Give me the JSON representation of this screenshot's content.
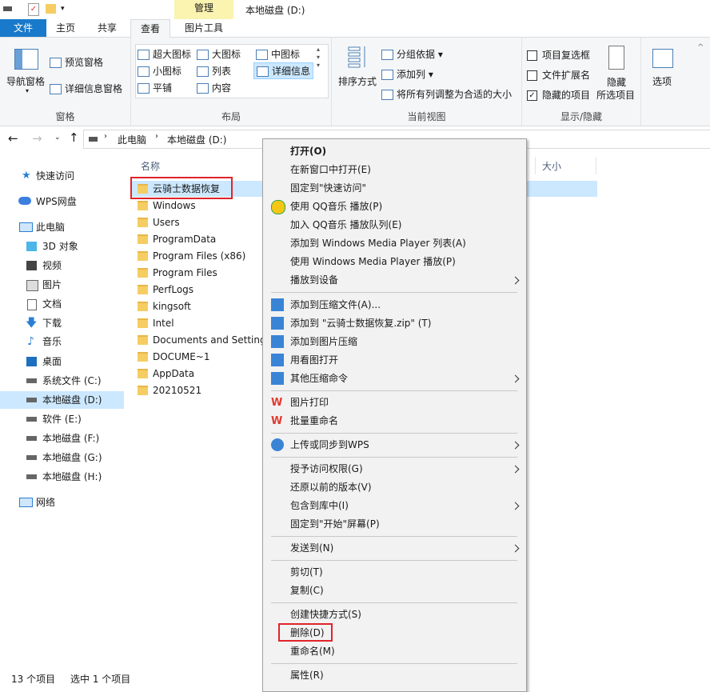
{
  "ribbon_tabs": {
    "file": "文件",
    "home": "主页",
    "share": "共享",
    "view": "查看",
    "picture_tools": "图片工具",
    "manage": "管理"
  },
  "window_title": "本地磁盘 (D:)",
  "panes": {
    "nav_pane": "导航窗格",
    "preview": "预览窗格",
    "details": "详细信息窗格",
    "group": "窗格"
  },
  "layout": {
    "xl_icons": "超大图标",
    "large_icons": "大图标",
    "medium_icons": "中图标",
    "small_icons": "小图标",
    "list": "列表",
    "details": "详细信息",
    "tiles": "平铺",
    "content": "内容",
    "group": "布局"
  },
  "current_view": {
    "sort_by": "排序方式",
    "group_by": "分组依据",
    "add_col": "添加列",
    "fit_cols": "将所有列调整为合适的大小",
    "group": "当前视图"
  },
  "show_hide": {
    "item_checkboxes": "项目复选框",
    "file_ext": "文件扩展名",
    "hidden_items": "隐藏的项目",
    "hide_selected_1": "隐藏",
    "hide_selected_2": "所选项目",
    "options": "选项",
    "group": "显示/隐藏"
  },
  "breadcrumb": {
    "pc": "此电脑",
    "drive": "本地磁盘 (D:)"
  },
  "columns": {
    "name": "名称",
    "size": "大小"
  },
  "nav": {
    "quick": "快速访问",
    "wps": "WPS网盘",
    "pc": "此电脑",
    "obj3d": "3D 对象",
    "video": "视频",
    "pictures": "图片",
    "docs": "文档",
    "downloads": "下载",
    "music": "音乐",
    "desktop": "桌面",
    "c": "系统文件 (C:)",
    "d": "本地磁盘 (D:)",
    "e": "软件 (E:)",
    "f": "本地磁盘 (F:)",
    "g": "本地磁盘 (G:)",
    "h": "本地磁盘 (H:)",
    "network": "网络"
  },
  "files": [
    "云骑士数据恢复",
    "Windows",
    "Users",
    "ProgramData",
    "Program Files (x86)",
    "Program Files",
    "PerfLogs",
    "kingsoft",
    "Intel",
    "Documents and Settings",
    "DOCUME~1",
    "AppData",
    "20210521"
  ],
  "menu": {
    "open": "打开(O)",
    "open_new": "在新窗口中打开(E)",
    "pin_quick": "固定到\"快速访问\"",
    "qq_play": "使用 QQ音乐 播放(P)",
    "qq_queue": "加入 QQ音乐 播放队列(E)",
    "wmp_list": "添加到 Windows Media Player 列表(A)",
    "wmp_play": "使用 Windows Media Player 播放(P)",
    "cast": "播放到设备",
    "add_zip": "添加到压缩文件(A)...",
    "add_named_zip": "添加到 \"云骑士数据恢复.zip\" (T)",
    "add_img_zip": "添加到图片压缩",
    "open_img": "用看图打开",
    "other_zip": "其他压缩命令",
    "pic_print": "图片打印",
    "batch_rename": "批量重命名",
    "wps_upload": "上传或同步到WPS",
    "grant": "授予访问权限(G)",
    "restore": "还原以前的版本(V)",
    "include_lib": "包含到库中(I)",
    "pin_start": "固定到\"开始\"屏幕(P)",
    "send_to": "发送到(N)",
    "cut": "剪切(T)",
    "copy": "复制(C)",
    "shortcut": "创建快捷方式(S)",
    "delete": "删除(D)",
    "rename": "重命名(M)",
    "props": "属性(R)"
  },
  "status": {
    "count": "13 个项目",
    "selected": "选中 1 个项目"
  },
  "colors": {
    "accent": "#1979ca",
    "highlight": "#cce8ff",
    "red_box": "#e0242a",
    "folder": "#f5cd63"
  }
}
